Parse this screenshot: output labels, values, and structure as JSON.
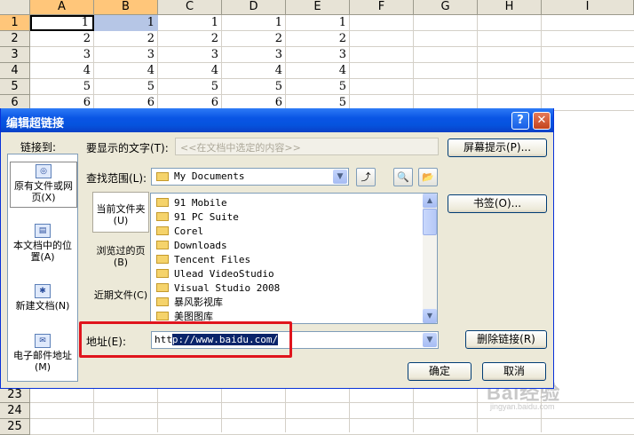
{
  "sheet": {
    "columns": [
      "A",
      "B",
      "C",
      "D",
      "E",
      "F",
      "G",
      "H",
      "I"
    ],
    "rows": [
      "1",
      "2",
      "3",
      "4",
      "5",
      "6",
      "23",
      "24",
      "25"
    ],
    "cells": [
      [
        "1",
        "1",
        "1",
        "1",
        "1"
      ],
      [
        "2",
        "2",
        "2",
        "2",
        "2"
      ],
      [
        "3",
        "3",
        "3",
        "3",
        "3"
      ],
      [
        "4",
        "4",
        "4",
        "4",
        "4"
      ],
      [
        "5",
        "5",
        "5",
        "5",
        "5"
      ],
      [
        "6",
        "6",
        "6",
        "6",
        "5"
      ]
    ]
  },
  "dialog": {
    "title": "编辑超链接",
    "help_label": "?",
    "close_label": "✕",
    "link_to_label": "链接到:",
    "link_to_items": [
      {
        "label": "原有文件或网页(X)",
        "selected": true
      },
      {
        "label": "本文档中的位置(A)",
        "selected": false
      },
      {
        "label": "新建文档(N)",
        "selected": false
      },
      {
        "label": "电子邮件地址(M)",
        "selected": false
      }
    ],
    "display_text_label": "要显示的文字(T):",
    "display_text_value": "<<在文档中选定的内容>>",
    "screentip_button": "屏幕提示(P)...",
    "look_in_label": "查找范围(L):",
    "look_in_value": "My Documents",
    "tabs": [
      {
        "label": "当前文件夹(U)",
        "selected": true
      },
      {
        "label": "浏览过的页(B)",
        "selected": false
      },
      {
        "label": "近期文件(C)",
        "selected": false
      }
    ],
    "files": [
      "91 Mobile",
      "91 PC Suite",
      "Corel",
      "Downloads",
      "Tencent Files",
      "Ulead VideoStudio",
      "Visual Studio 2008",
      "暴风影视库",
      "美图图库"
    ],
    "bookmark_button": "书签(O)...",
    "address_label": "地址(E):",
    "address_prefix": "htt",
    "address_selected": "p://www.baidu.com/",
    "remove_link_button": "删除链接(R)",
    "ok_button": "确定",
    "cancel_button": "取消"
  },
  "watermark": {
    "text": "Bai经验",
    "sub": "jingyan.baidu.com"
  }
}
